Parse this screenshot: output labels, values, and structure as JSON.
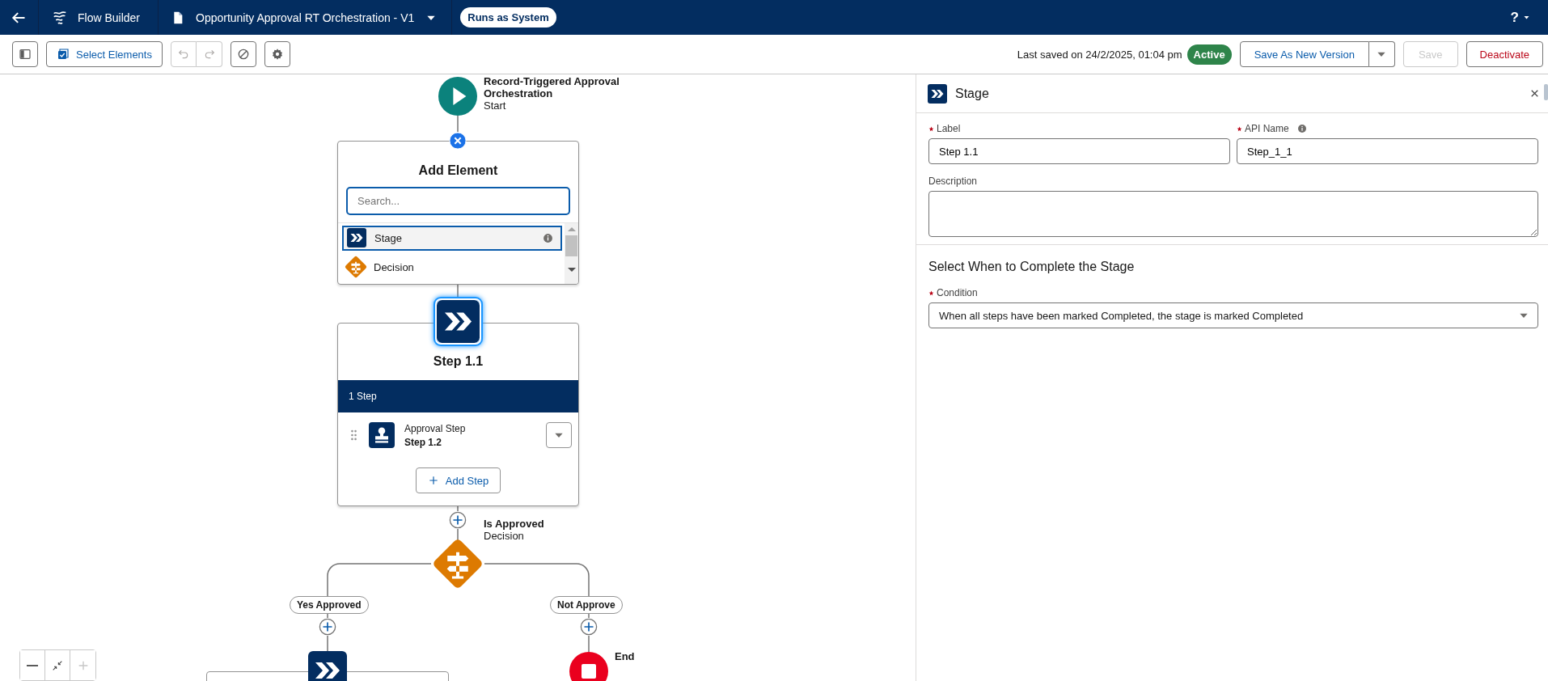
{
  "header": {
    "app_title": "Flow Builder",
    "flow_name": "Opportunity Approval RT Orchestration - V1",
    "run_mode": "Runs as System",
    "help": "?"
  },
  "toolbar": {
    "tools": [
      {
        "kind": "panel",
        "disabled": false
      },
      {
        "kind": "select",
        "label": "Select Elements",
        "disabled": false
      },
      {
        "kind": "undo",
        "disabled": true
      },
      {
        "kind": "redo",
        "disabled": true
      },
      {
        "kind": "block",
        "disabled": false
      },
      {
        "kind": "settings",
        "disabled": false
      }
    ],
    "last_saved": "Last saved on 24/2/2025, 01:04 pm",
    "status": "Active",
    "actions": [
      {
        "label": "Save As New Version",
        "kind": "split",
        "disabled": false
      },
      {
        "label": "Save",
        "kind": "plain",
        "disabled": true
      },
      {
        "label": "Deactivate",
        "kind": "danger",
        "disabled": false
      }
    ]
  },
  "canvas": {
    "start": {
      "title": "Record-Triggered Approval Orchestration",
      "subtitle": "Start"
    },
    "add_element": {
      "title": "Add Element",
      "placeholder": "Search...",
      "items": [
        {
          "label": "Stage",
          "kind": "stage",
          "selected": true
        },
        {
          "label": "Decision",
          "kind": "decision",
          "selected": false
        }
      ]
    },
    "stage": {
      "title": "Step 1.1",
      "step_count": "1 Step",
      "steps": [
        {
          "type": "Approval Step",
          "name": "Step 1.2"
        }
      ],
      "add_step": "Add Step"
    },
    "decision": {
      "title": "Is Approved",
      "subtitle": "Decision",
      "branches": [
        {
          "label": "Yes Approved",
          "target": {
            "kind": "stage"
          }
        },
        {
          "label": "Not Approve",
          "target": {
            "kind": "end",
            "label": "End"
          }
        }
      ]
    },
    "zoom_controls": [
      {
        "kind": "zoom_out",
        "disabled": false
      },
      {
        "kind": "fit",
        "disabled": false
      },
      {
        "kind": "zoom_in",
        "disabled": true
      }
    ]
  },
  "panel": {
    "title": "Stage",
    "fields": [
      {
        "label": "Label",
        "required": true,
        "info": false,
        "value": "Step 1.1"
      },
      {
        "label": "API Name",
        "required": true,
        "info": true,
        "value": "Step_1_1"
      }
    ],
    "description": {
      "label": "Description"
    },
    "section_title": "Select When to Complete the Stage",
    "condition": {
      "label": "Condition",
      "required": true,
      "value": "When all steps have been marked Completed, the stage is marked Completed"
    }
  }
}
